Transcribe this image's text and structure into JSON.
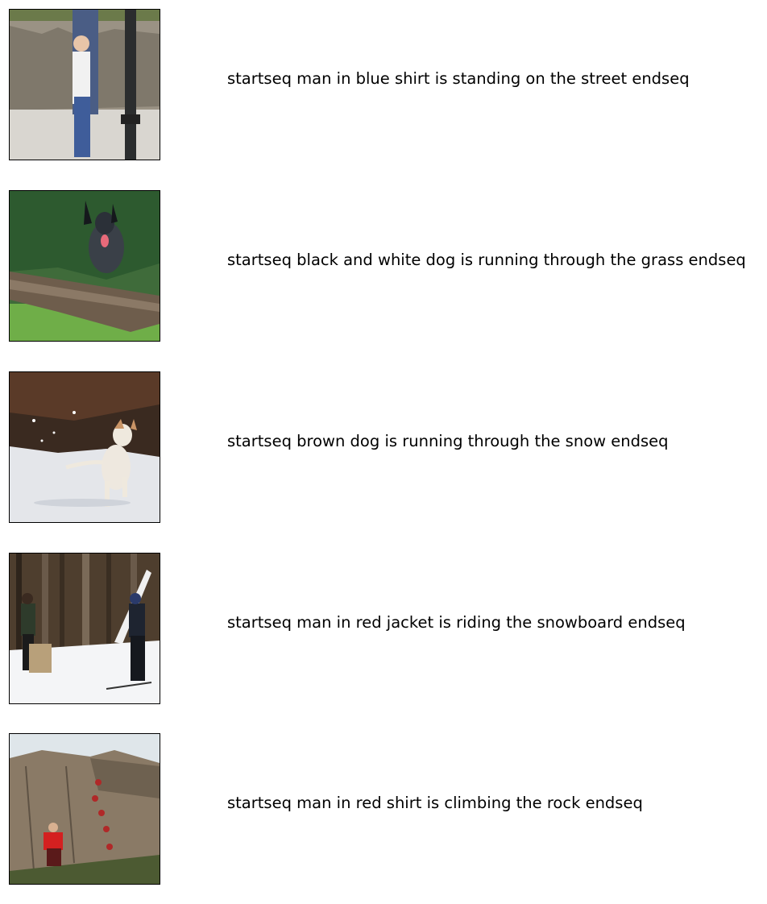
{
  "rows": [
    {
      "caption": "startseq man in blue shirt is standing on the street endseq"
    },
    {
      "caption": "startseq black and white dog is running through the grass endseq"
    },
    {
      "caption": "startseq brown dog is running through the snow endseq"
    },
    {
      "caption": "startseq man in red jacket is riding the snowboard endseq"
    },
    {
      "caption": "startseq man in red shirt is climbing the rock endseq"
    }
  ]
}
